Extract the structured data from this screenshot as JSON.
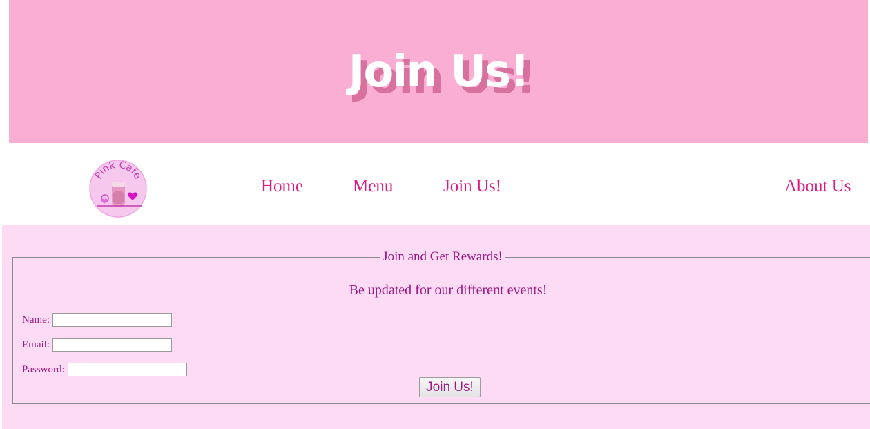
{
  "banner": {
    "title": "Join Us!"
  },
  "nav": {
    "logo_text": "Pink Cafe",
    "links": [
      {
        "label": "Home"
      },
      {
        "label": "Menu"
      },
      {
        "label": "Join Us!"
      },
      {
        "label": "About Us"
      }
    ]
  },
  "form": {
    "legend": "Join and Get Rewards!",
    "subtitle": "Be updated for our different events!",
    "fields": [
      {
        "label": "Name:",
        "value": ""
      },
      {
        "label": "Email:",
        "value": ""
      },
      {
        "label": "Password:",
        "value": ""
      }
    ],
    "submit_label": "Join Us!"
  },
  "colors": {
    "banner_bg": "#fbaed4",
    "title_shadow": "#d9719f",
    "nav_link": "#e0187f",
    "main_bg": "#fddbf4",
    "form_text": "#9b1a84"
  }
}
